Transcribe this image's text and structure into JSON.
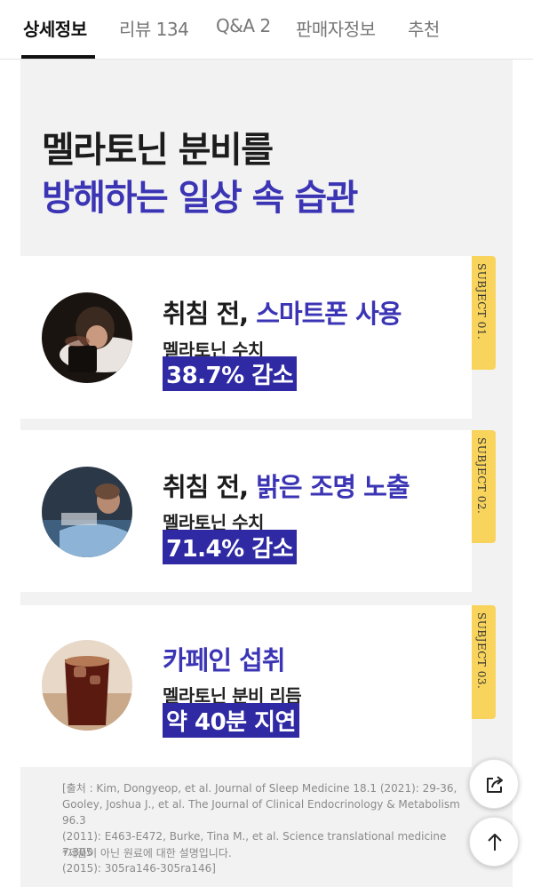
{
  "tabs": [
    {
      "label": "상세정보",
      "active": true
    },
    {
      "label": "리뷰 134",
      "active": false
    },
    {
      "label": "Q&A 2",
      "active": false
    },
    {
      "label": "판매자정보",
      "active": false
    },
    {
      "label": "추천",
      "active": false
    }
  ],
  "headline": {
    "line1": "멜라토닌 분비를",
    "line2": "방해하는 일상 속 습관"
  },
  "cards": [
    {
      "title_prefix": "취침 전, ",
      "title_accent": "스마트폰 사용",
      "label": "멜라토닌 수치",
      "badge": "38.7% 감소",
      "tag": "SUBJECT 01.",
      "photo": "woman-using-phone-in-bed"
    },
    {
      "title_prefix": "취침 전, ",
      "title_accent": "밝은 조명 노출",
      "label": "멜라토닌 수치",
      "badge": "71.4% 감소",
      "tag": "SUBJECT 02.",
      "photo": "woman-watching-tv-at-night"
    },
    {
      "title_prefix": "",
      "title_accent": "카페인 섭취",
      "label": "멜라토닌 분비 리듬",
      "badge": "약 40분 지연",
      "tag": "SUBJECT 03.",
      "photo": "iced-coffee-glass"
    }
  ],
  "source": {
    "lines": [
      "[출처 : Kim, Dongyeop, et al. Journal of Sleep Medicine 18.1 (2021): 29-36,",
      "Gooley, Joshua J., et al. The Journal of Clinical Endocrinology & Metabolism 96.3",
      "(2011): E463-E472, Burke, Tina M., et al. Science translational medicine 7.305",
      "(2015): 305ra146-305ra146]"
    ],
    "note": "*제품이 아닌 원료에 대한 설명입니다."
  },
  "fabs": {
    "share_icon": "share-icon",
    "top_icon": "arrow-up-icon"
  },
  "colors": {
    "accent": "#3b35b5",
    "badge": "#2f2aa3",
    "tag": "#f8d45c",
    "panel": "#f2f2f2"
  }
}
